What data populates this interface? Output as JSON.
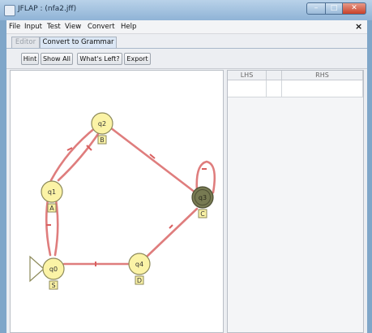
{
  "window": {
    "title": "JFLAP : (nfa2.jff)",
    "minimize_glyph": "–",
    "maximize_glyph": "□",
    "close_glyph": "✕"
  },
  "menubar": {
    "items": [
      "File",
      "Input",
      "Test",
      "View",
      "Convert",
      "Help"
    ],
    "close_glyph": "×"
  },
  "tabs": [
    {
      "label": "Editor",
      "active": false
    },
    {
      "label": "Convert to Grammar",
      "active": true
    }
  ],
  "toolbar": {
    "buttons": [
      "Hint",
      "Show All",
      "What's Left?",
      "Export"
    ]
  },
  "automaton": {
    "states": [
      {
        "name": "q0",
        "label": "S",
        "initial": true,
        "final": false
      },
      {
        "name": "q1",
        "label": "A",
        "initial": false,
        "final": false
      },
      {
        "name": "q2",
        "label": "B",
        "initial": false,
        "final": false
      },
      {
        "name": "q3",
        "label": "C",
        "initial": false,
        "final": true
      },
      {
        "name": "q4",
        "label": "D",
        "initial": false,
        "final": false
      }
    ],
    "transitions": [
      {
        "from": "q0",
        "to": "q1"
      },
      {
        "from": "q1",
        "to": "q0"
      },
      {
        "from": "q1",
        "to": "q2"
      },
      {
        "from": "q2",
        "to": "q1"
      },
      {
        "from": "q2",
        "to": "q3"
      },
      {
        "from": "q0",
        "to": "q4"
      },
      {
        "from": "q4",
        "to": "q3"
      },
      {
        "from": "q3",
        "to": "q3"
      }
    ],
    "colors": {
      "state_fill": "#fbf3a6",
      "state_stroke": "#8d8a5a",
      "final_fill": "#777a52",
      "transition": "#df7d7d"
    }
  },
  "grammar_table": {
    "columns": [
      "LHS",
      "",
      "RHS"
    ],
    "rows": []
  }
}
